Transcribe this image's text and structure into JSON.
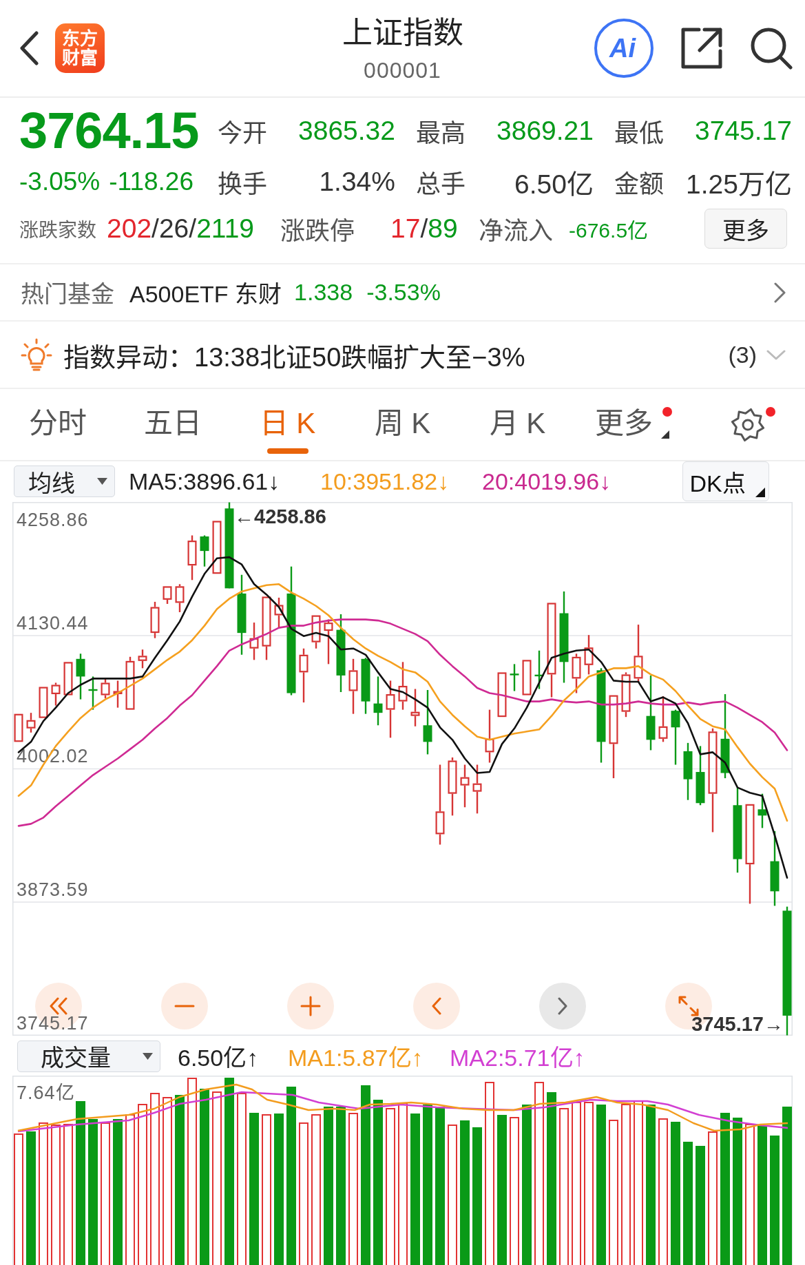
{
  "header": {
    "logo": "东方财富",
    "title": "上证指数",
    "code": "000001",
    "ai_label": "Ai"
  },
  "quote": {
    "price": "3764.15",
    "change_percent": "-3.05%",
    "change": "-118.26",
    "falling": true,
    "stats": [
      {
        "label": "今开",
        "value": "3865.32",
        "color": "#079a1b"
      },
      {
        "label": "最高",
        "value": "3869.21",
        "color": "#079a1b"
      },
      {
        "label": "最低",
        "value": "3745.17",
        "color": "#079a1b"
      },
      {
        "label": "换手",
        "value": "1.34%",
        "color": "#333333"
      },
      {
        "label": "总手",
        "value": "6.50亿",
        "color": "#333333"
      },
      {
        "label": "金额",
        "value": "1.25万亿",
        "color": "#333333"
      }
    ],
    "breadth": {
      "label": "涨跌家数",
      "parts": [
        {
          "text": "202",
          "color": "#e3262d"
        },
        {
          "text": "/26/",
          "color": "#333333"
        },
        {
          "text": "2119",
          "color": "#079a1b"
        }
      ]
    },
    "limits": {
      "label": "涨跌停",
      "parts": [
        {
          "text": "17",
          "color": "#e3262d"
        },
        {
          "text": "/",
          "color": "#333333"
        },
        {
          "text": "89",
          "color": "#079a1b"
        }
      ]
    },
    "net_inflow": {
      "label": "净流入",
      "value": "-676.5亿",
      "falling": true
    },
    "more_button": "更多"
  },
  "hot_fund": {
    "label": "热门基金",
    "name": "A500ETF 东财",
    "price": "1.338",
    "change": "-3.53%",
    "falling": true
  },
  "alert": {
    "text": "指数异动：13:38北证50跌幅扩大至−3%",
    "count": "(3)",
    "expanded": false
  },
  "tabs": [
    {
      "label": "分时",
      "kind": "tab",
      "selected": false,
      "dot": false
    },
    {
      "label": "五日",
      "kind": "tab",
      "selected": false,
      "dot": false
    },
    {
      "label": "日 K",
      "kind": "tab",
      "selected": true,
      "dot": false
    },
    {
      "label": "周 K",
      "kind": "tab",
      "selected": false,
      "dot": false
    },
    {
      "label": "月 K",
      "kind": "tab",
      "selected": false,
      "dot": false
    },
    {
      "label": "更多",
      "kind": "menu",
      "selected": false,
      "dot": true
    }
  ],
  "settings": {
    "dot": true
  },
  "indicators": {
    "selector": "均线",
    "items": [
      {
        "text": "MA5:3896.61↓",
        "color": "#222222"
      },
      {
        "text": "10:3951.82↓",
        "color": "#f39c1e"
      },
      {
        "text": "20:4019.96↓",
        "color": "#c9298f"
      }
    ],
    "mode_button": "DK点"
  },
  "chart": {
    "top_label": "4258.86",
    "chart_data": {
      "type": "candlestick",
      "grid": true,
      "ylim": [
        3745.17,
        4258.86
      ],
      "yticks": [
        4130.44,
        4002.02,
        3873.59,
        3745.17
      ],
      "ohlc": [
        [
          4028,
          4055,
          4028,
          4055
        ],
        [
          4041,
          4056,
          4037,
          4049
        ],
        [
          4051,
          4081,
          4051,
          4081
        ],
        [
          4074,
          4085,
          4063,
          4083
        ],
        [
          4073,
          4105,
          4073,
          4105
        ],
        [
          4108,
          4113,
          4069,
          4091
        ],
        [
          4078,
          4091,
          4059,
          4078
        ],
        [
          4073,
          4089,
          4070,
          4085
        ],
        [
          4074,
          4087,
          4061,
          4077
        ],
        [
          4059,
          4110,
          4059,
          4106
        ],
        [
          4106,
          4117,
          4099,
          4111
        ],
        [
          4133,
          4163,
          4128,
          4158
        ],
        [
          4165,
          4178,
          4161,
          4178
        ],
        [
          4162,
          4180,
          4153,
          4178
        ],
        [
          4198,
          4227,
          4184,
          4222
        ],
        [
          4226,
          4227,
          4197,
          4212
        ],
        [
          4190,
          4241,
          4190,
          4241
        ],
        [
          4253,
          4258.86,
          4176,
          4176
        ],
        [
          4171,
          4189,
          4112,
          4133
        ],
        [
          4118,
          4143,
          4107,
          4128
        ],
        [
          4120,
          4168,
          4107,
          4168
        ],
        [
          4150,
          4167,
          4138,
          4160
        ],
        [
          4171,
          4197,
          4073,
          4075
        ],
        [
          4095,
          4118,
          4066,
          4112
        ],
        [
          4124,
          4150,
          4118,
          4150
        ],
        [
          4135,
          4146,
          4103,
          4143
        ],
        [
          4136,
          4151,
          4076,
          4092
        ],
        [
          4077,
          4108,
          4055,
          4097
        ],
        [
          4108,
          4109,
          4055,
          4067
        ],
        [
          4065,
          4091,
          4044,
          4056
        ],
        [
          4059,
          4087,
          4032,
          4074
        ],
        [
          4067,
          4105,
          4059,
          4082
        ],
        [
          4053,
          4079,
          4043,
          4057
        ],
        [
          4044,
          4078,
          4016,
          4028
        ],
        [
          3939,
          4006,
          3929,
          3961
        ],
        [
          3978,
          4013,
          3957,
          4010
        ],
        [
          3986,
          4006,
          3965,
          3994
        ],
        [
          3980,
          4006,
          3959,
          3988
        ],
        [
          4018,
          4059,
          4008,
          4031
        ],
        [
          4052,
          4095,
          4052,
          4095
        ],
        [
          4093,
          4103,
          4077,
          4093
        ],
        [
          4073,
          4107,
          4073,
          4107
        ],
        [
          4092,
          4116,
          4079,
          4092
        ],
        [
          4093,
          4162,
          4071,
          4162
        ],
        [
          4152,
          4173,
          4085,
          4105
        ],
        [
          4089,
          4113,
          4075,
          4110
        ],
        [
          4102,
          4131,
          4093,
          4119
        ],
        [
          4097,
          4099,
          4008,
          4028
        ],
        [
          4026,
          4073,
          3993,
          4073
        ],
        [
          4057,
          4095,
          4052,
          4093
        ],
        [
          4089,
          4141,
          4086,
          4111
        ],
        [
          4053,
          4092,
          4020,
          4030
        ],
        [
          4031,
          4072,
          4028,
          4043
        ],
        [
          4058,
          4059,
          4006,
          4042
        ],
        [
          4019,
          4027,
          3972,
          3992
        ],
        [
          3999,
          4024,
          3967,
          3969
        ],
        [
          3978,
          4041,
          3941,
          4038
        ],
        [
          4031,
          4074,
          3993,
          3998
        ],
        [
          3967,
          3984,
          3902,
          3915
        ],
        [
          3910,
          3968,
          3872,
          3968
        ],
        [
          3963,
          3978,
          3945,
          3957
        ],
        [
          3913,
          3942,
          3870,
          3884
        ],
        [
          3865.32,
          3869.21,
          3745.17,
          3764.15
        ]
      ]
    },
    "moving_averages": {
      "chart_data": {
        "type": "line",
        "ylim": [
          3745.17,
          4258.86
        ],
        "series": [
          {
            "color": "#111111",
            "values": [
              4018,
              4028,
              4048,
              4061,
              4075,
              4083,
              4089,
              4089,
              4089,
              4089,
              4091,
              4109,
              4126,
              4144,
              4168,
              4190,
              4205,
              4206,
              4199,
              4180,
              4170,
              4158,
              4137,
              4130,
              4133,
              4130,
              4117,
              4118,
              4112,
              4095,
              4079,
              4076,
              4069,
              4061,
              4042,
              4030,
              4012,
              3998,
              3999,
              4026,
              4041,
              4061,
              4085,
              4109,
              4113,
              4116,
              4117,
              4105,
              4087,
              4086,
              4086,
              4067,
              4071,
              4065,
              4046,
              4016,
              4018,
              4008,
              3984,
              3979,
              3976,
              3938,
              3897
            ]
          },
          {
            "color": "#f5a01f",
            "values": [
              3976,
              3986,
              4006,
              4024,
              4038,
              4051,
              4061,
              4069,
              4075,
              4082,
              4089,
              4098,
              4107,
              4115,
              4126,
              4140,
              4156,
              4166,
              4173,
              4176,
              4179,
              4180,
              4172,
              4166,
              4159,
              4150,
              4138,
              4127,
              4118,
              4111,
              4105,
              4098,
              4095,
              4086,
              4067,
              4054,
              4043,
              4033,
              4030,
              4033,
              4036,
              4038,
              4040,
              4053,
              4068,
              4079,
              4091,
              4095,
              4099,
              4099,
              4101,
              4093,
              4088,
              4077,
              4063,
              4050,
              4043,
              4040,
              4023,
              4007,
              3994,
              3983,
              3952
            ]
          },
          {
            "color": "#cf2a93",
            "values": [
              3947,
              3949,
              3955,
              3966,
              3976,
              3986,
              3996,
              4004,
              4012,
              4021,
              4030,
              4041,
              4051,
              4063,
              4073,
              4087,
              4101,
              4116,
              4122,
              4127,
              4132,
              4138,
              4140,
              4140,
              4143,
              4145,
              4146,
              4146,
              4146,
              4145,
              4142,
              4137,
              4132,
              4125,
              4112,
              4101,
              4091,
              4080,
              4075,
              4073,
              4070,
              4067,
              4067,
              4069,
              4067,
              4066,
              4067,
              4064,
              4064,
              4065,
              4067,
              4065,
              4064,
              4064,
              4066,
              4064,
              4066,
              4067,
              4061,
              4054,
              4047,
              4037,
              4020
            ]
          }
        ]
      }
    },
    "high_marker": "←4258.86",
    "low_marker": "3745.17→",
    "controls": [
      {
        "kind": "first",
        "disabled": false
      },
      {
        "kind": "zoom_out",
        "disabled": false
      },
      {
        "kind": "zoom_in",
        "disabled": false
      },
      {
        "kind": "previous",
        "disabled": false
      },
      {
        "kind": "next",
        "disabled": true
      },
      {
        "kind": "fullscreen",
        "disabled": false
      }
    ]
  },
  "volume": {
    "selector": "成交量",
    "items": [
      {
        "text": "6.50亿↑",
        "color": "#222222"
      },
      {
        "text": "MA1:5.87亿↑",
        "color": "#f39c1e"
      },
      {
        "text": "MA2:5.71亿↑",
        "color": "#d23fd2"
      }
    ],
    "y_label": "7.64亿"
  }
}
